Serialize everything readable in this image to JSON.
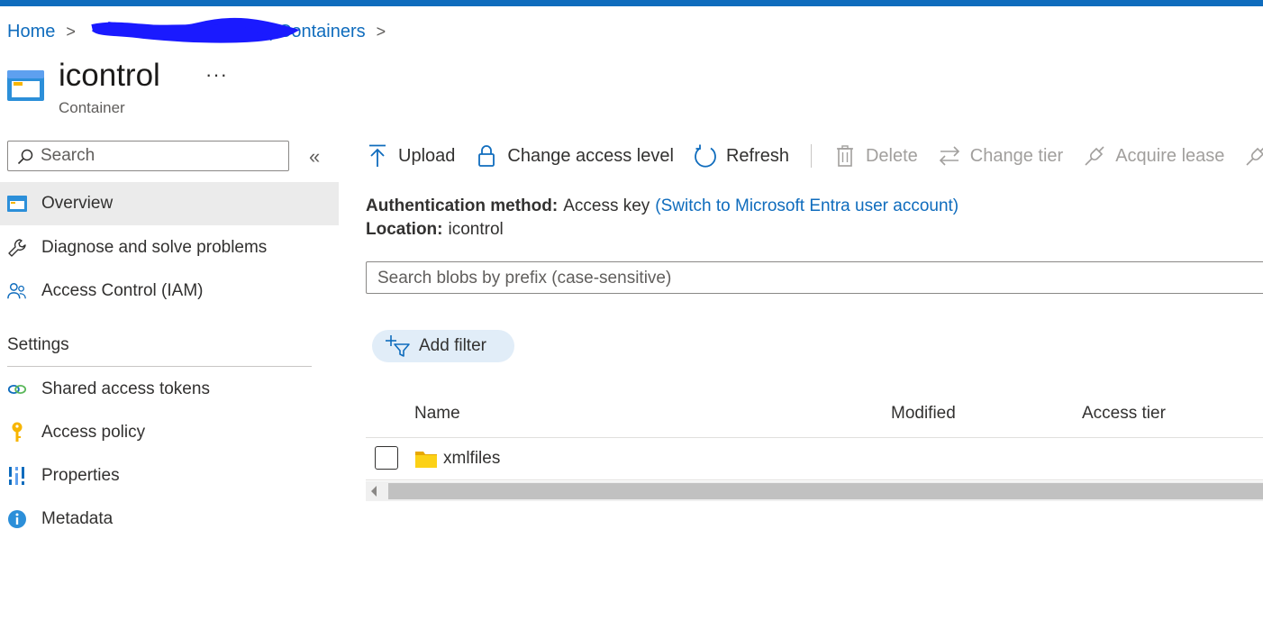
{
  "colors": {
    "accent": "#0f6cbd",
    "active_nav": "#ebebeb",
    "filter_pill": "#e1edf8",
    "folder": "#fcd116"
  },
  "breadcrumb": {
    "home": "Home",
    "resource": "acdev001 | Containers"
  },
  "header": {
    "title": "icontrol",
    "subtitle": "Container",
    "more": "···"
  },
  "sidebar": {
    "search_placeholder": "Search",
    "collapse_icon": "«",
    "items": [
      {
        "label": "Overview",
        "icon": "container-icon",
        "active": true
      },
      {
        "label": "Diagnose and solve problems",
        "icon": "wrench-icon"
      },
      {
        "label": "Access Control (IAM)",
        "icon": "people-icon"
      }
    ],
    "settings_heading": "Settings",
    "settings_items": [
      {
        "label": "Shared access tokens",
        "icon": "link-icon"
      },
      {
        "label": "Access policy",
        "icon": "key-icon"
      },
      {
        "label": "Properties",
        "icon": "properties-icon"
      },
      {
        "label": "Metadata",
        "icon": "info-icon"
      }
    ]
  },
  "toolbar": {
    "upload": "Upload",
    "change_access": "Change access level",
    "refresh": "Refresh",
    "delete": "Delete",
    "change_tier": "Change tier",
    "acquire_lease": "Acquire lease"
  },
  "info": {
    "auth_label": "Authentication method:",
    "auth_value": "Access key",
    "auth_link": "(Switch to Microsoft Entra user account)",
    "location_label": "Location:",
    "location_value": "icontrol"
  },
  "blob_search": {
    "placeholder": "Search blobs by prefix (case-sensitive)"
  },
  "filter": {
    "label": "Add filter"
  },
  "table": {
    "columns": [
      "Name",
      "Modified",
      "Access tier"
    ],
    "rows": [
      {
        "name": "xmlfiles",
        "type": "folder",
        "modified": "",
        "access_tier": ""
      }
    ]
  }
}
